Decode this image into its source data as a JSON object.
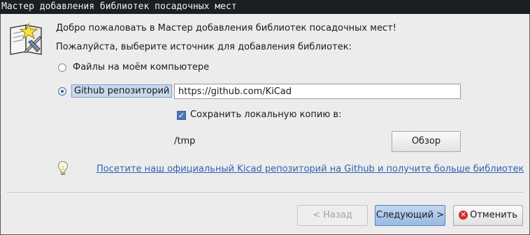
{
  "window": {
    "title": "Мастер добавления библиотек посадочных мест"
  },
  "intro": {
    "welcome": "Добро пожаловать в Мастер добавления библиотек посадочных мест!",
    "prompt": "Пожалуйста, выберите источник для добавления библиотек:"
  },
  "source": {
    "local_label": "Файлы на моём компьютере",
    "local_selected": false,
    "github_label": "Github репозиторий",
    "github_selected": true,
    "github_url": "https://github.com/KiCad"
  },
  "local_copy": {
    "checkbox_label": "Сохранить локальную копию в:",
    "checked": true,
    "path": "/tmp",
    "browse_label": "Обзор"
  },
  "tip": {
    "link_text": "Посетите наш официальный Kicad репозиторий на Github и получите больше библиотек"
  },
  "footer": {
    "back_label": "< Назад",
    "next_label": "Следующий >",
    "cancel_label": "Отменить"
  },
  "icons": {
    "wizard": "wizard-book-icon",
    "tip": "lightbulb-icon",
    "cancel": "cancel-x-icon"
  }
}
